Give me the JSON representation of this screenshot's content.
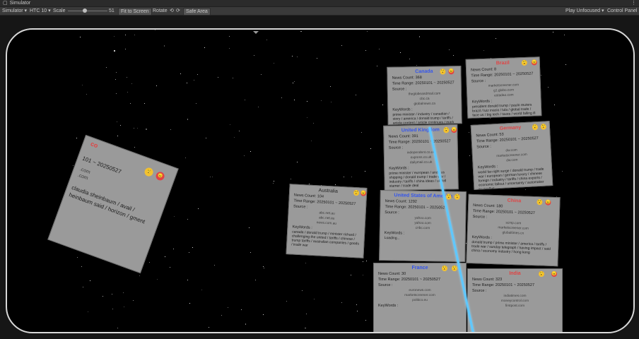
{
  "window": {
    "title": "Simulator"
  },
  "toolbar": {
    "simulator": "Simulator",
    "device": "HTC 10",
    "scale_label": "Scale",
    "scale_value": "51",
    "fit_button": "Fit to Screen",
    "rotate_label": "Rotate",
    "safe_area": "Safe Area",
    "play_mode": "Play Unfocused",
    "control_panel": "Control Panel"
  },
  "cards": [
    {
      "name": "Canada",
      "count": "News Count: 368",
      "range": "Time Range: 20250101 ~ 20250527",
      "sources": [
        "theglobeandmail.com",
        "cbc.ca",
        "globalnews.ca"
      ],
      "keywords": "prime minister / industry / canadian / story / america / donald trump / tariffs / article content / article continues / mark carney"
    },
    {
      "name": "Brazil",
      "count": "News Count: 8",
      "range": "Time Range: 20250101 ~ 20250527",
      "sources": [
        "marketscreener.com",
        "g1.globo.com",
        "estadao.com"
      ],
      "keywords": "president donald trump / paulo reuters brazil / luiz inacio / lula / global trade / face us / big tech / taxes / world falling ill / soon wall / markets / fire ira agreed"
    },
    {
      "name": "United Kingdom",
      "count": "News Count: 391",
      "range": "Time Range: 20250101 ~ 20250527",
      "sources": [
        "independent.co.uk",
        "express.co.uk",
        "dailymail.co.uk"
      ],
      "keywords": "prime minister / european / and / us shipping / donald trump / trade war / industry / tariffs / china ideas / uk fell stamer / trade deal"
    },
    {
      "name": "Germany",
      "count": "News Count: 53",
      "range": "Time Range: 20250101 ~ 20250527",
      "sources": [
        "dw.com",
        "marketscreener.com",
        "dw.com"
      ],
      "keywords": "world far-right surge / donald trump / trade war / european / german luxury / chinese foreign / industry / tariffs / china exports / economic fallout / uncertainty / automaker tw conflict"
    },
    {
      "name": "Australia",
      "count": "News Count: 104",
      "range": "Time Range: 20250101 ~ 20250527",
      "sources": [
        "abc.net.au",
        "abc.net.au",
        "news.com.au"
      ],
      "keywords": "canada / donald trump / minister richard / challenging the united / tariffs / chinese / trump tariffs / australian companies / goods / trade war"
    },
    {
      "name": "United States of America",
      "count": "News Count: 1292",
      "range": "Time Range: 20250101 ~ 20250527",
      "sources": [
        "yahoo.com",
        "yahoo.com",
        "cnbc.com"
      ],
      "keywords": "Loading..."
    },
    {
      "name": "China",
      "count": "News Count: 180",
      "range": "Time Range: 20250101 ~ 20250527",
      "sources": [
        "scmp.com",
        "marketscreener.com",
        "globaltimes.cn"
      ],
      "keywords": "donald trump / prime minister / america / tariffs / trade war / sunday telegraph / having impact / said china / economy industry / hong kong"
    },
    {
      "name": "France",
      "count": "News Count: 30",
      "range": "Time Range: 20250101 ~ 20250527",
      "sources": [
        "euronews.com",
        "marketscreener.com",
        "politico.eu"
      ],
      "keywords": ""
    },
    {
      "name": "India",
      "count": "News Count: 323",
      "range": "Time Range: 20250101 ~ 20250527",
      "sources": [
        "indiatimes.com",
        "moneycontrol.com",
        "firstpost.com"
      ],
      "keywords": ""
    },
    {
      "name": "Mexico",
      "count": "",
      "range": "101 ~ 20250527",
      "sources": [
        "m",
        ".com",
        ".com"
      ],
      "keywords": "claudia sheinbaum / avail / heinbaum said / horizon / gment"
    }
  ],
  "labels": {
    "source": "Source :",
    "keywords": "KeyWords :"
  },
  "icons": {
    "face1": "astonished-face-icon",
    "face2": "angry-face-icon"
  }
}
